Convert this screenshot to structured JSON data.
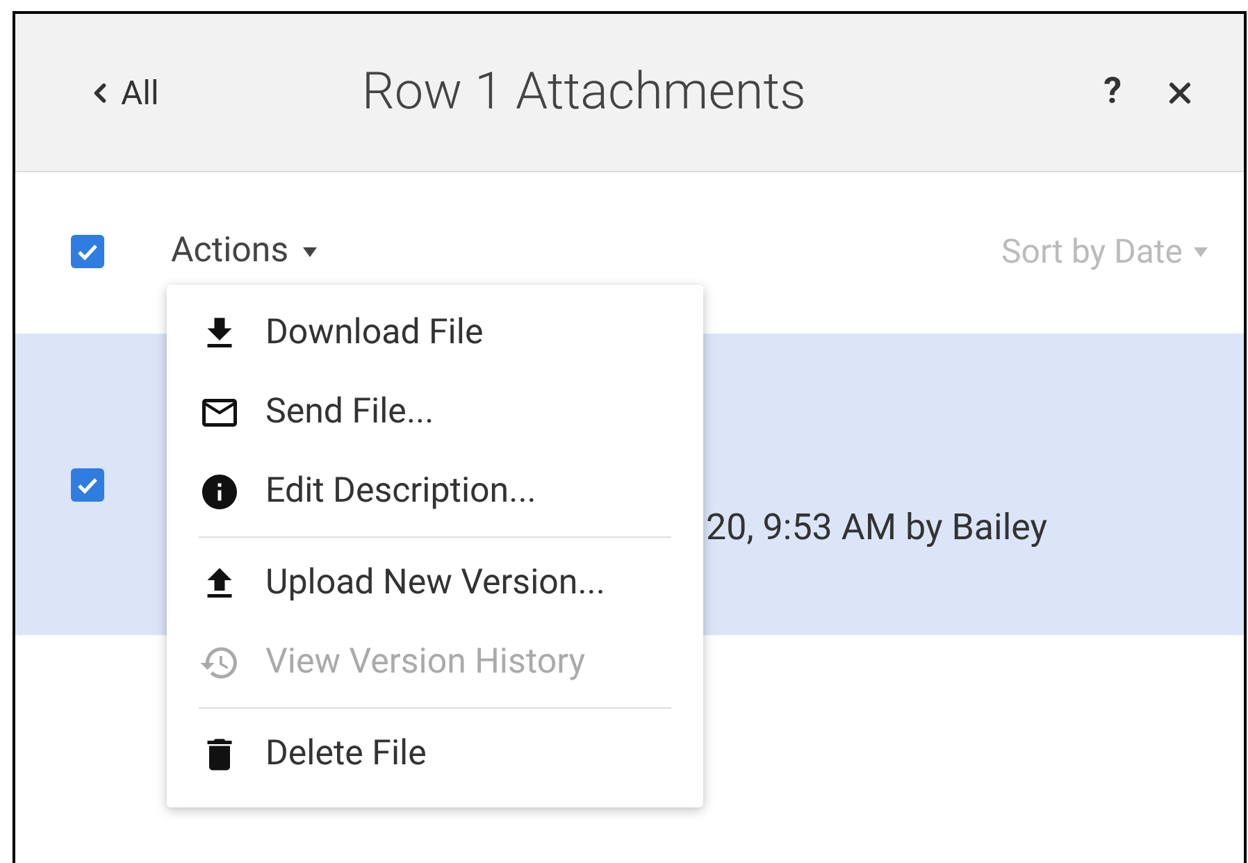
{
  "header": {
    "back_label": "All",
    "title": "Row 1 Attachments",
    "help": "?"
  },
  "toolbar": {
    "select_all": {
      "checked": true
    },
    "actions_label": "Actions",
    "sort_label": "Sort by Date"
  },
  "rows": [
    {
      "checked": true,
      "selected": true,
      "detail": "20, 9:53 AM by Bailey"
    }
  ],
  "actions_menu": {
    "groups": [
      [
        {
          "label": "Download File",
          "disabled": false
        },
        {
          "label": "Send File...",
          "disabled": false
        },
        {
          "label": "Edit Description...",
          "disabled": false
        }
      ],
      [
        {
          "label": "Upload New Version...",
          "disabled": false
        },
        {
          "label": "View Version History",
          "disabled": true
        }
      ],
      [
        {
          "label": "Delete File",
          "disabled": false
        }
      ]
    ]
  }
}
